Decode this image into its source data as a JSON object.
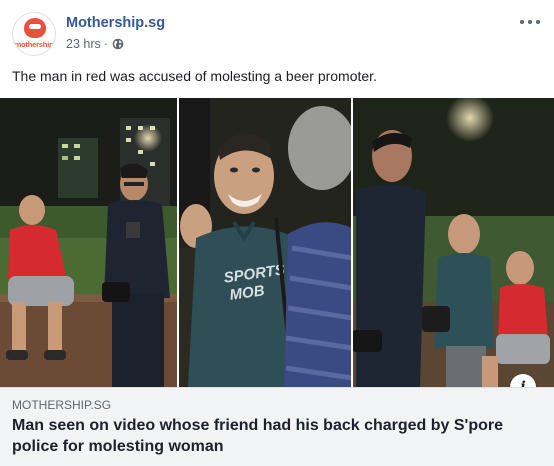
{
  "post": {
    "page_name": "Mothership.sg",
    "avatar_text": "mothership",
    "time": "23 hrs",
    "separator": "·",
    "caption": "The man in red was accused of molesting a beer promoter."
  },
  "link_preview": {
    "domain": "MOTHERSHIP.SG",
    "headline": "Man seen on video whose friend had his back charged by S'pore police for molesting woman"
  },
  "photo": {
    "shirt_text_line1": "SPORTS",
    "shirt_text_line2": "MOB"
  },
  "icons": {
    "globe": "globe-icon",
    "more": "more-options-icon",
    "info": "info-icon"
  },
  "colors": {
    "brand": "#e8513d",
    "link": "#365899",
    "preview_bg": "#f2f3f5"
  }
}
